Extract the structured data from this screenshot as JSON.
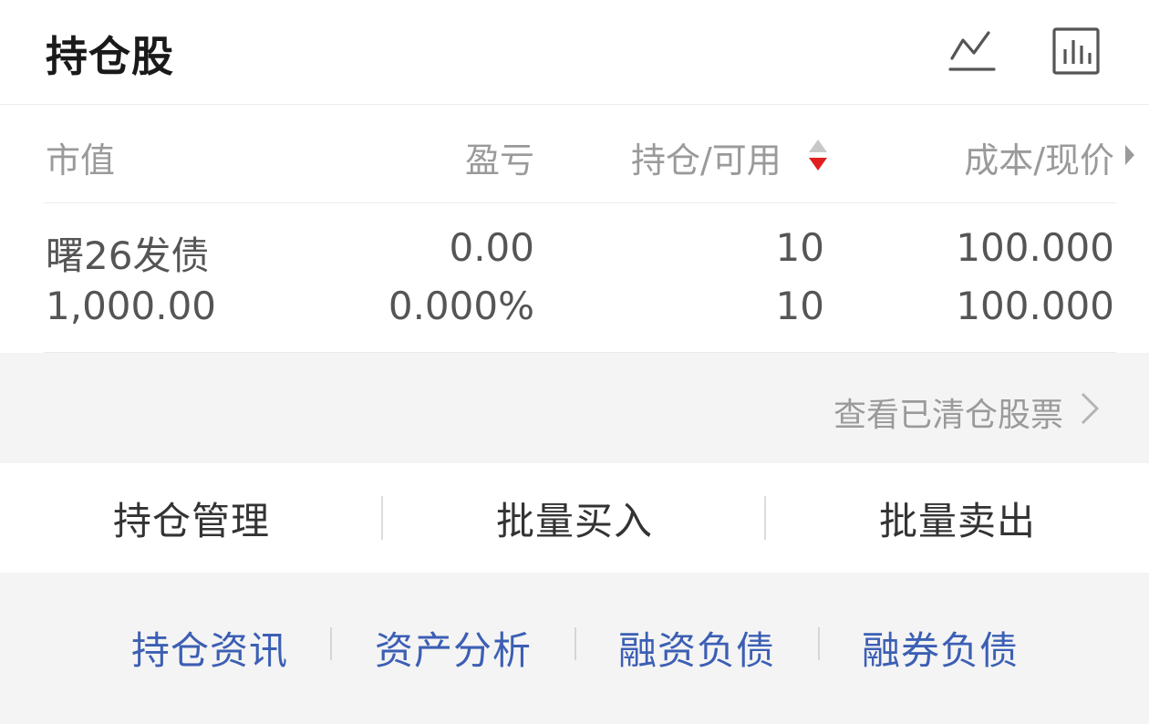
{
  "header": {
    "title": "持仓股",
    "icons": [
      "line-chart-icon",
      "bar-chart-icon"
    ]
  },
  "table": {
    "columns": [
      "市值",
      "盈亏",
      "持仓/可用",
      "成本/现价"
    ],
    "rows": [
      {
        "name": "曙26发债",
        "market_value": "1,000.00",
        "profit": "0.00",
        "profit_pct": "0.000%",
        "position": "10",
        "available": "10",
        "cost": "100.000",
        "price": "100.000"
      }
    ]
  },
  "cleared_link": "查看已清仓股票",
  "actions": [
    "持仓管理",
    "批量买入",
    "批量卖出"
  ],
  "links": [
    "持仓资讯",
    "资产分析",
    "融资负债",
    "融券负债"
  ],
  "colors": {
    "link": "#3c5fb4",
    "sort_active": "#e02020",
    "sort_inactive": "#c8c8c8"
  }
}
